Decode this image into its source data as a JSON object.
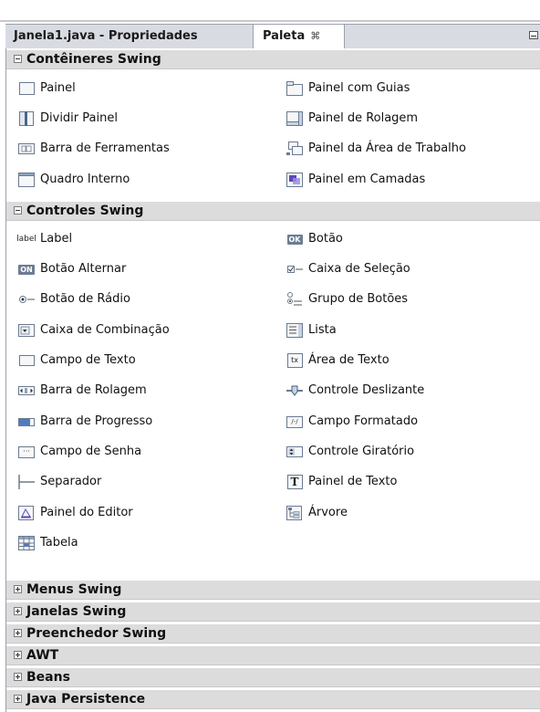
{
  "tabs": {
    "properties": "Janela1.java - Propriedades",
    "palette": "Paleta",
    "palette_close": "⌘"
  },
  "categories": {
    "containers": "Contêineres Swing",
    "controls": "Controles Swing",
    "menus": "Menus Swing",
    "windows": "Janelas Swing",
    "filler": "Preenchedor Swing",
    "awt": "AWT",
    "beans": "Beans",
    "persistence": "Java Persistence"
  },
  "containers": [
    {
      "label": "Painel",
      "icon": "panel-icon"
    },
    {
      "label": "Painel com Guias",
      "icon": "tabbed-pane-icon"
    },
    {
      "label": "Dividir Painel",
      "icon": "split-pane-icon"
    },
    {
      "label": "Painel de Rolagem",
      "icon": "scroll-pane-icon"
    },
    {
      "label": "Barra de Ferramentas",
      "icon": "toolbar-icon"
    },
    {
      "label": "Painel da Área de Trabalho",
      "icon": "desktop-pane-icon"
    },
    {
      "label": "Quadro Interno",
      "icon": "internal-frame-icon"
    },
    {
      "label": "Painel em Camadas",
      "icon": "layered-pane-icon"
    }
  ],
  "controls": [
    {
      "label": "Label",
      "icon": "label-icon"
    },
    {
      "label": "Botão",
      "icon": "button-icon"
    },
    {
      "label": "Botão Alternar",
      "icon": "toggle-button-icon"
    },
    {
      "label": "Caixa de Seleção",
      "icon": "checkbox-icon"
    },
    {
      "label": "Botão de Rádio",
      "icon": "radio-button-icon"
    },
    {
      "label": "Grupo de Botões",
      "icon": "button-group-icon"
    },
    {
      "label": "Caixa de Combinação",
      "icon": "combo-box-icon"
    },
    {
      "label": "Lista",
      "icon": "list-icon"
    },
    {
      "label": "Campo de Texto",
      "icon": "text-field-icon"
    },
    {
      "label": "Área de Texto",
      "icon": "text-area-icon"
    },
    {
      "label": "Barra de Rolagem",
      "icon": "scrollbar-icon"
    },
    {
      "label": "Controle Deslizante",
      "icon": "slider-icon"
    },
    {
      "label": "Barra de Progresso",
      "icon": "progress-bar-icon"
    },
    {
      "label": "Campo Formatado",
      "icon": "formatted-field-icon"
    },
    {
      "label": "Campo de Senha",
      "icon": "password-field-icon"
    },
    {
      "label": "Controle Giratório",
      "icon": "spinner-icon"
    },
    {
      "label": "Separador",
      "icon": "separator-icon"
    },
    {
      "label": "Painel de Texto",
      "icon": "text-pane-icon"
    },
    {
      "label": "Painel do Editor",
      "icon": "editor-pane-icon"
    },
    {
      "label": "Árvore",
      "icon": "tree-icon"
    },
    {
      "label": "Tabela",
      "icon": "table-icon"
    }
  ],
  "icon_text": {
    "label": "label",
    "button": "OK",
    "toggle": "ON",
    "textarea": "tx",
    "textpane": "T",
    "password": "···",
    "formatted": "/-/"
  }
}
